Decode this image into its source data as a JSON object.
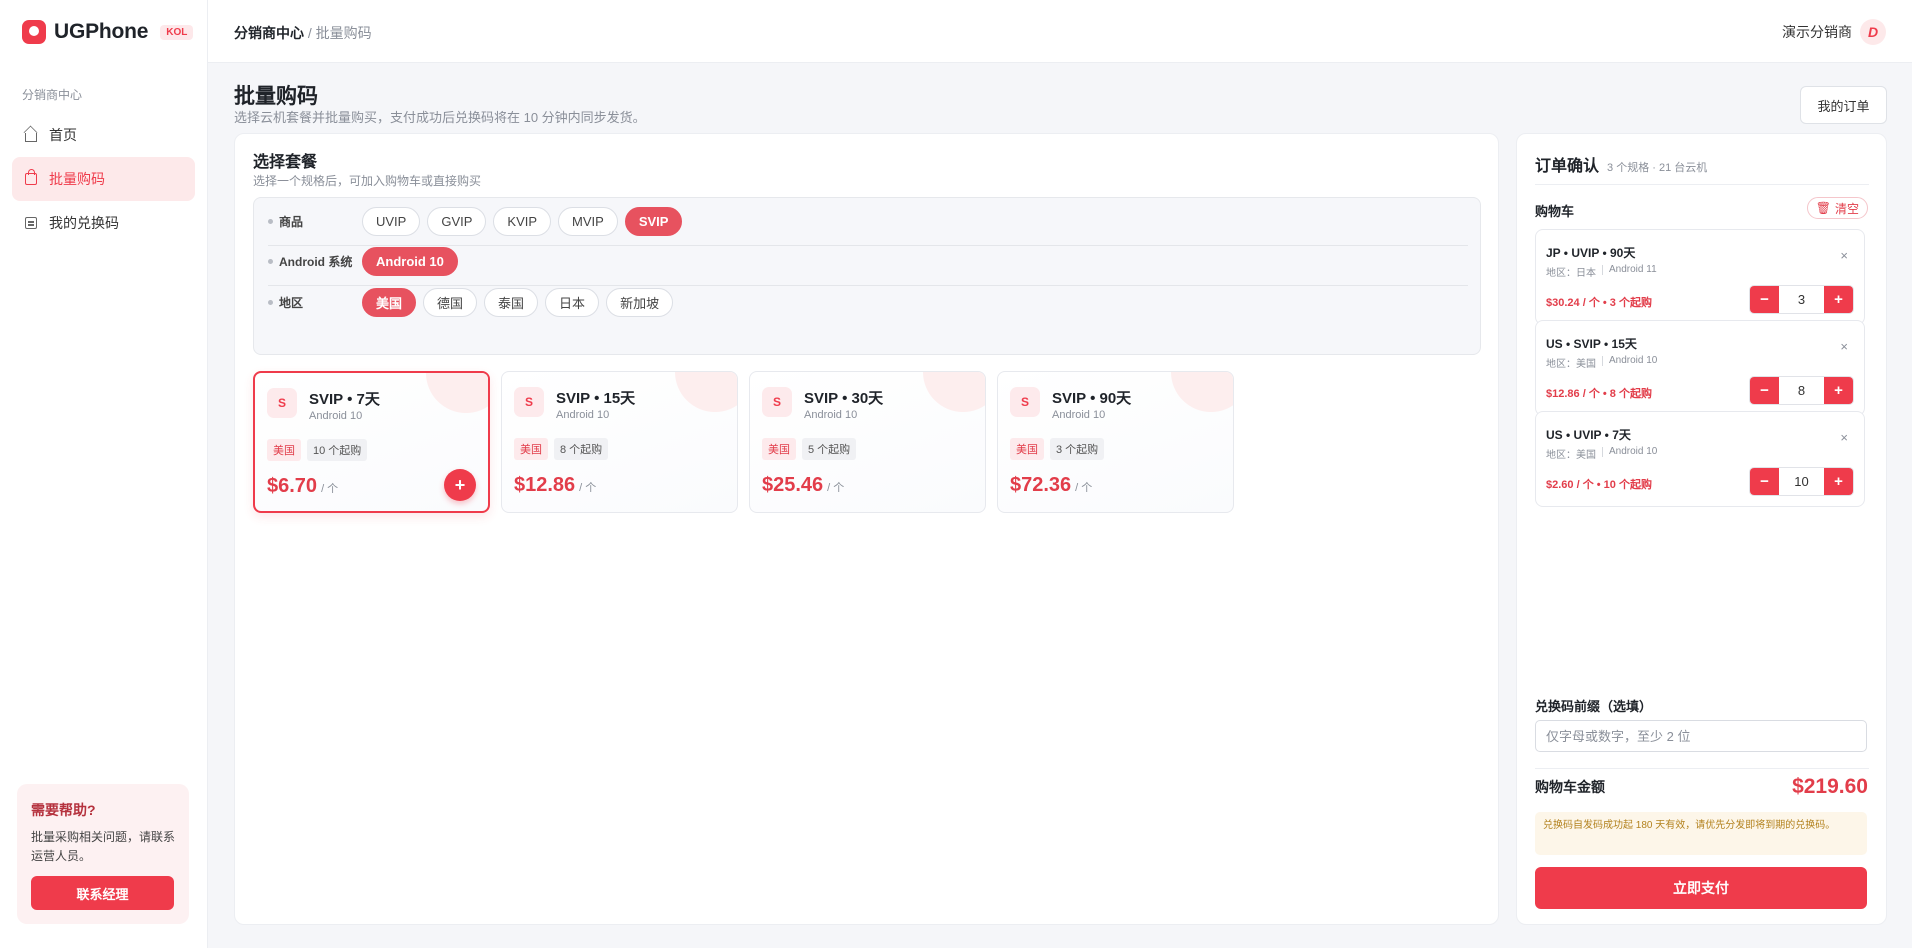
{
  "brand": {
    "name": "UGPhone",
    "badge": "KOL"
  },
  "sidebar": {
    "section": "分销商中心",
    "items": [
      {
        "label": "首页",
        "icon": "home-icon",
        "active": false
      },
      {
        "label": "批量购码",
        "icon": "shopping-bag-icon",
        "active": true
      },
      {
        "label": "我的兑换码",
        "icon": "list-icon",
        "active": false
      }
    ],
    "help": {
      "title": "需要帮助?",
      "text": "批量采购相关问题，请联系运营人员。",
      "button": "联系经理"
    }
  },
  "header": {
    "breadcrumb_root": "分销商中心",
    "breadcrumb_sep": "/",
    "breadcrumb_leaf": "批量购码",
    "user_name": "演示分销商",
    "avatar_letter": "D"
  },
  "page": {
    "title": "批量购码",
    "subtitle": "选择云机套餐并批量购买，支付成功后兑换码将在 10 分钟内同步发货。",
    "orders_button": "我的订单"
  },
  "selector": {
    "title": "选择套餐",
    "subtitle": "选择一个规格后，可加入购物车或直接购买",
    "rows": [
      {
        "label": "商品",
        "options": [
          "UVIP",
          "GVIP",
          "KVIP",
          "MVIP",
          "SVIP"
        ],
        "selected": "SVIP"
      },
      {
        "label": "Android 系统",
        "options": [
          "Android 10"
        ],
        "selected": "Android 10"
      },
      {
        "label": "地区",
        "options": [
          "美国",
          "德国",
          "泰国",
          "日本",
          "新加坡"
        ],
        "selected": "美国"
      }
    ]
  },
  "plans": [
    {
      "icon": "S",
      "name": "SVIP • 7天",
      "os": "Android 10",
      "region": "美国",
      "min": "10 个起购",
      "price": "$6.70",
      "unit": "/ 个",
      "selected": true
    },
    {
      "icon": "S",
      "name": "SVIP • 15天",
      "os": "Android 10",
      "region": "美国",
      "min": "8 个起购",
      "price": "$12.86",
      "unit": "/ 个",
      "selected": false
    },
    {
      "icon": "S",
      "name": "SVIP • 30天",
      "os": "Android 10",
      "region": "美国",
      "min": "5 个起购",
      "price": "$25.46",
      "unit": "/ 个",
      "selected": false
    },
    {
      "icon": "S",
      "name": "SVIP • 90天",
      "os": "Android 10",
      "region": "美国",
      "min": "3 个起购",
      "price": "$72.36",
      "unit": "/ 个",
      "selected": false
    }
  ],
  "add_symbol": "+",
  "order": {
    "title": "订单确认",
    "meta": "3 个规格 · 21 台云机",
    "cart_title": "购物车",
    "clear_label": "清空",
    "items": [
      {
        "name": "JP • UVIP • 90天",
        "region": "地区：日本",
        "os": "Android 11",
        "price": "$30.24 / 个 • 3 个起购",
        "qty": "3"
      },
      {
        "name": "US • SVIP • 15天",
        "region": "地区：美国",
        "os": "Android 10",
        "price": "$12.86 / 个 • 8 个起购",
        "qty": "8"
      },
      {
        "name": "US • UVIP • 7天",
        "region": "地区：美国",
        "os": "Android 10",
        "price": "$2.60 / 个 • 10 个起购",
        "qty": "10"
      }
    ],
    "minus": "−",
    "plus": "+",
    "close": "×",
    "prefix_label": "兑换码前缀（选填）",
    "prefix_placeholder": "仅字母或数字，至少 2 位",
    "total_label": "购物车金额",
    "total_value": "$219.60",
    "notice": "兑换码自发码成功起 180 天有效，请优先分发即将到期的兑换码。",
    "pay_button": "立即支付"
  },
  "colors": {
    "accent": "#ef3b4b",
    "top_accent": "#1aa3dc"
  }
}
